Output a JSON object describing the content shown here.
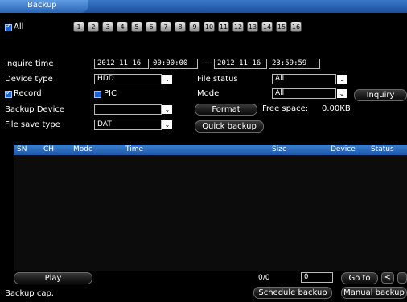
{
  "window": {
    "title": "Backup"
  },
  "channels": {
    "all_label": "All",
    "numbers": [
      "1",
      "2",
      "3",
      "4",
      "5",
      "6",
      "7",
      "8",
      "9",
      "10",
      "11",
      "12",
      "13",
      "14",
      "15",
      "16"
    ]
  },
  "form": {
    "inquire_time_label": "Inquire time",
    "start_date": "2012–11–16",
    "start_time": "00:00:00",
    "range_sep": "—",
    "end_date": "2012–11–16",
    "end_time": "23:59:59",
    "device_type_label": "Device type",
    "device_type_value": "HDD",
    "file_status_label": "File status",
    "file_status_value": "All",
    "record_label": "Record",
    "pic_label": "PIC",
    "mode_label": "Mode",
    "mode_value": "All",
    "inquiry_button": "Inquiry",
    "backup_device_label": "Backup Device",
    "backup_device_value": "",
    "format_button": "Format",
    "free_space_label": "Free space:",
    "free_space_value": "0.00KB",
    "file_save_type_label": "File save type",
    "file_save_type_value": "DAT",
    "quick_backup_button": "Quick backup"
  },
  "table": {
    "columns": [
      "SN",
      "CH",
      "Mode",
      "Time",
      "Size",
      "Device",
      "Status"
    ],
    "rows": []
  },
  "footer": {
    "play_button": "Play",
    "page_info": "0/0",
    "page_input": "0",
    "goto_button": "Go to",
    "prev_icon": "<",
    "backup_cap_label": "Backup cap.",
    "schedule_backup_button": "Schedule backup",
    "manual_backup_button": "Manual backup"
  }
}
